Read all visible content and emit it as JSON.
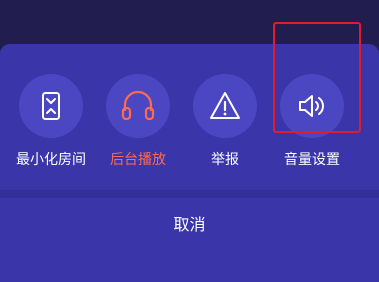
{
  "actions": [
    {
      "label": "最小化房间",
      "icon": "minimize-icon"
    },
    {
      "label": "后台播放",
      "icon": "headphones-icon"
    },
    {
      "label": "举报",
      "icon": "warning-icon"
    },
    {
      "label": "音量设置",
      "icon": "volume-icon"
    }
  ],
  "cancel_label": "取消",
  "colors": {
    "sheet": "#3a35a8",
    "icon_circle": "#4b46c2",
    "active_label": "#ff6a4d",
    "highlight": "#e11d2b"
  }
}
